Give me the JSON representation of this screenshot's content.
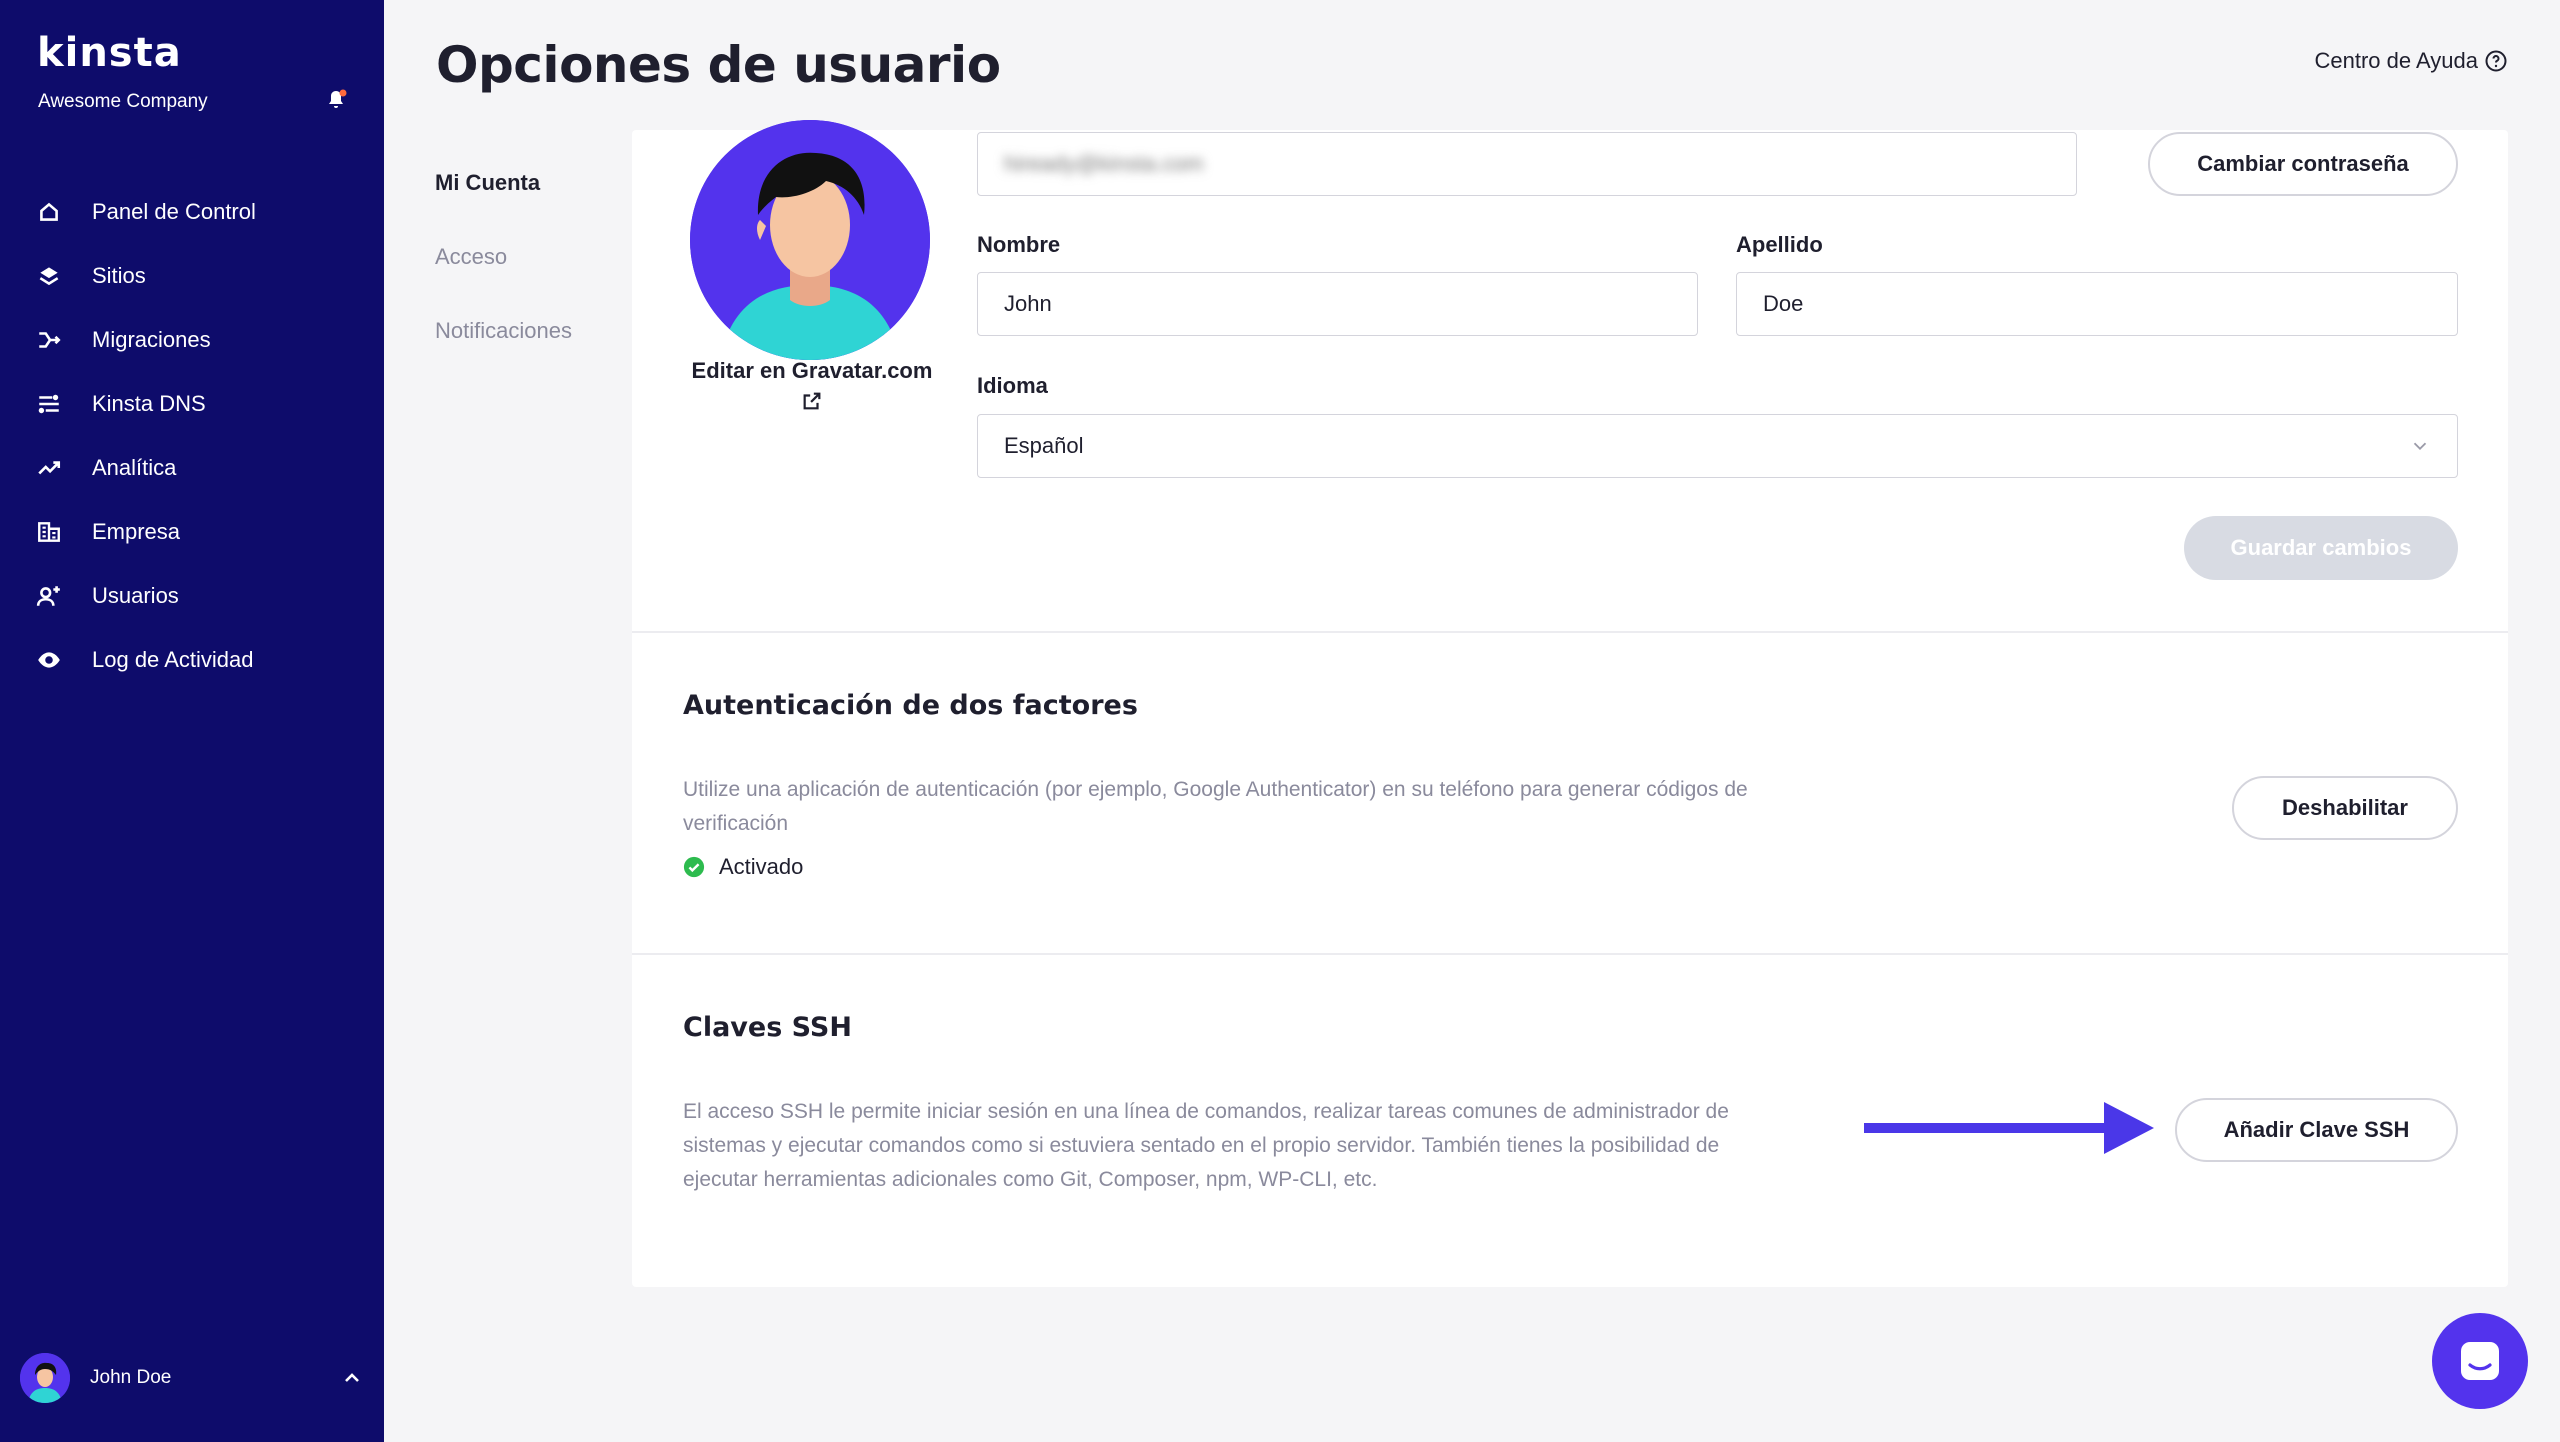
{
  "sidebar": {
    "logo": "kinsta",
    "company": "Awesome Company",
    "nav": [
      {
        "label": "Panel de Control",
        "icon": "home-icon"
      },
      {
        "label": "Sitios",
        "icon": "layers-icon"
      },
      {
        "label": "Migraciones",
        "icon": "migrate-icon"
      },
      {
        "label": "Kinsta DNS",
        "icon": "dns-icon"
      },
      {
        "label": "Analítica",
        "icon": "trend-icon"
      },
      {
        "label": "Empresa",
        "icon": "building-icon"
      },
      {
        "label": "Usuarios",
        "icon": "add-user-icon"
      },
      {
        "label": "Log de Actividad",
        "icon": "eye-icon"
      }
    ],
    "user": {
      "name": "John Doe"
    }
  },
  "header": {
    "title": "Opciones de usuario",
    "help": "Centro de Ayuda"
  },
  "subnav": {
    "items": [
      "Mi Cuenta",
      "Acceso",
      "Notificaciones"
    ]
  },
  "account": {
    "gravatar_link": "Editar en Gravatar.com",
    "email_value": "hiready@kinsta.com",
    "change_password": "Cambiar contraseña",
    "first_name_label": "Nombre",
    "first_name_value": "John",
    "last_name_label": "Apellido",
    "last_name_value": "Doe",
    "language_label": "Idioma",
    "language_value": "Español",
    "save": "Guardar cambios"
  },
  "twofa": {
    "title": "Autenticación de dos factores",
    "desc_line1": "Utilize una aplicación de autenticación (por ejemplo, Google Authenticator) en su teléfono para generar códigos de",
    "desc_line2": "verificación",
    "status": "Activado",
    "button": "Deshabilitar"
  },
  "ssh": {
    "title": "Claves SSH",
    "desc_line1": "El acceso SSH le permite iniciar sesión en una línea de comandos, realizar tareas comunes de administrador de",
    "desc_line2": "sistemas y ejecutar comandos como si estuviera sentado en el propio servidor. También tienes la posibilidad de",
    "desc_line3": "ejecutar herramientas adicionales como Git, Composer, npm, WP-CLI, etc.",
    "button": "Añadir Clave SSH"
  },
  "colors": {
    "sidebar": "#0e0c6b",
    "accent": "#5333ed",
    "success": "#2dbb4e"
  }
}
